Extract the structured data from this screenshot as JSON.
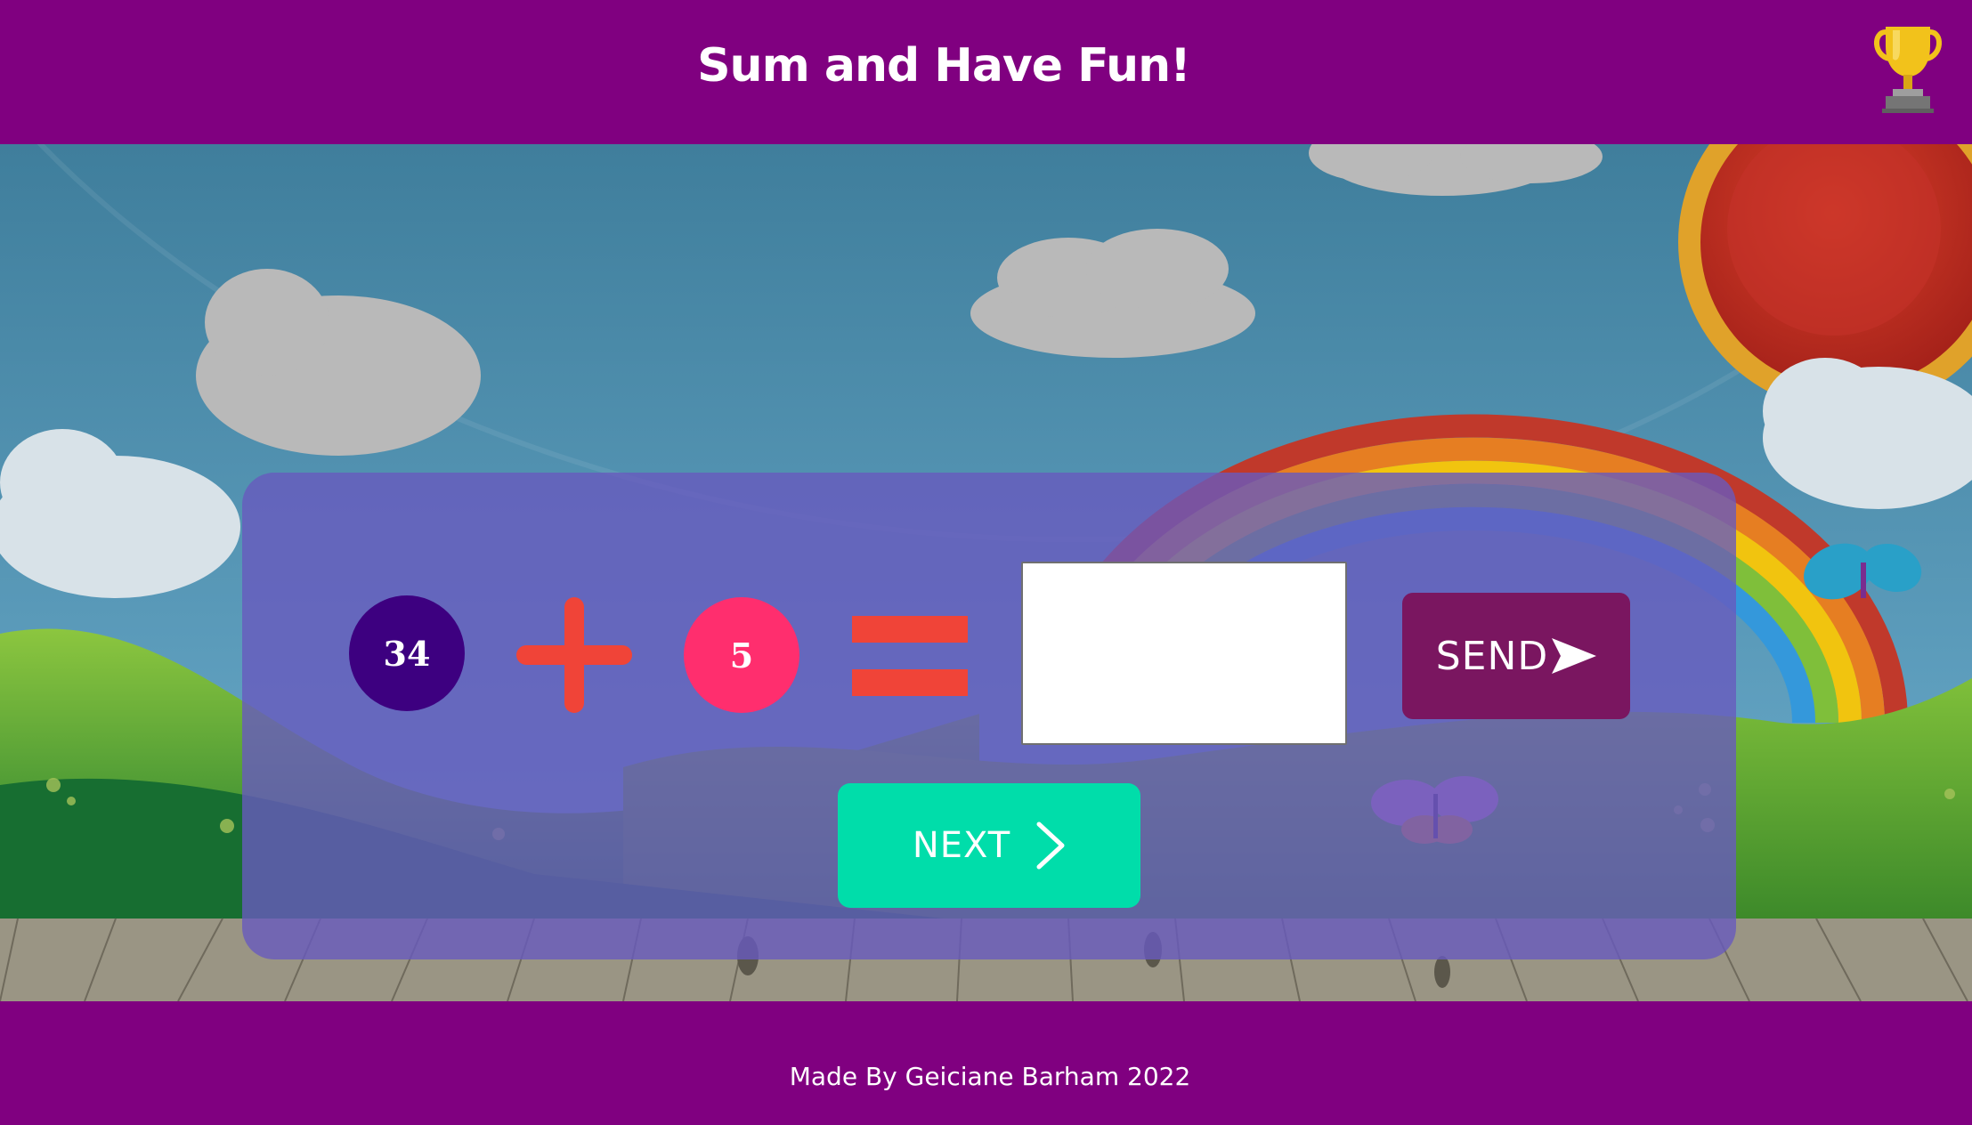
{
  "header": {
    "title": "Sum and Have Fun!",
    "icon": "trophy-icon"
  },
  "quiz": {
    "operand_a": "34",
    "operator": "plus-icon",
    "operand_b": "5",
    "equals": "equals-icon",
    "answer_value": "",
    "send_label": "SEND",
    "send_icon": "send-arrow-icon",
    "next_label": "NEXT",
    "next_icon": "chevron-right-icon"
  },
  "footer": {
    "credit": "Made By Geiciane Barham 2022"
  },
  "colors": {
    "header_bg": "#800080",
    "operand_a_bg": "#3d0080",
    "operand_b_bg": "#ff2e6e",
    "operator_color": "#f04438",
    "send_bg": "#7a1660",
    "next_bg": "#00ddaa"
  }
}
